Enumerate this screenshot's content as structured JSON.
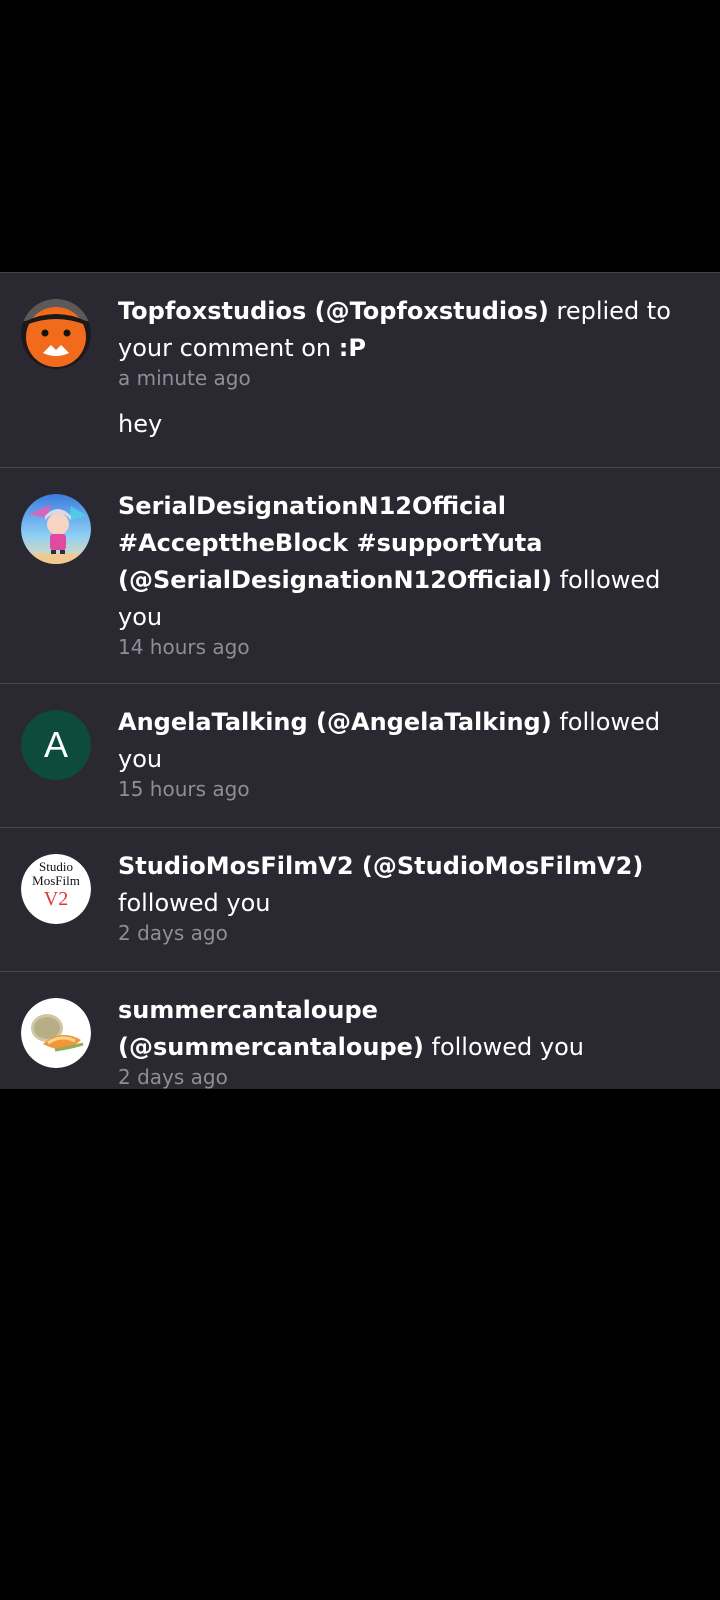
{
  "notifications": [
    {
      "name": "Topfoxstudios (@Topfoxstudios)",
      "action": " replied to your comment on ",
      "target": ":P",
      "time": "a minute ago",
      "comment": "hey",
      "avatar": "fox-avatar"
    },
    {
      "name": "SerialDesignationN12Official #AccepttheBlock #supportYuta (@SerialDesignationN12Official)",
      "action": " followed you",
      "time": "14 hours ago",
      "avatar": "anime-avatar"
    },
    {
      "name": "AngelaTalking (@AngelaTalking)",
      "action": " followed you",
      "time": "15 hours ago",
      "avatar_letter": "A",
      "avatar_color": "#0d4c3c"
    },
    {
      "name": "StudioMosFilmV2 (@StudioMosFilmV2)",
      "action": " followed you",
      "time": "2 days ago",
      "avatar_lines": [
        "Studio",
        "MosFilm",
        "V2"
      ]
    },
    {
      "name": "summercantaloupe (@summercantaloupe)",
      "action": " followed you",
      "time": "2 days ago",
      "avatar": "cantaloupe-avatar"
    }
  ],
  "colors": {
    "background": "#000000",
    "list_background": "#2a2831",
    "divider": "#4a4851",
    "time_text": "#8f8d96"
  }
}
